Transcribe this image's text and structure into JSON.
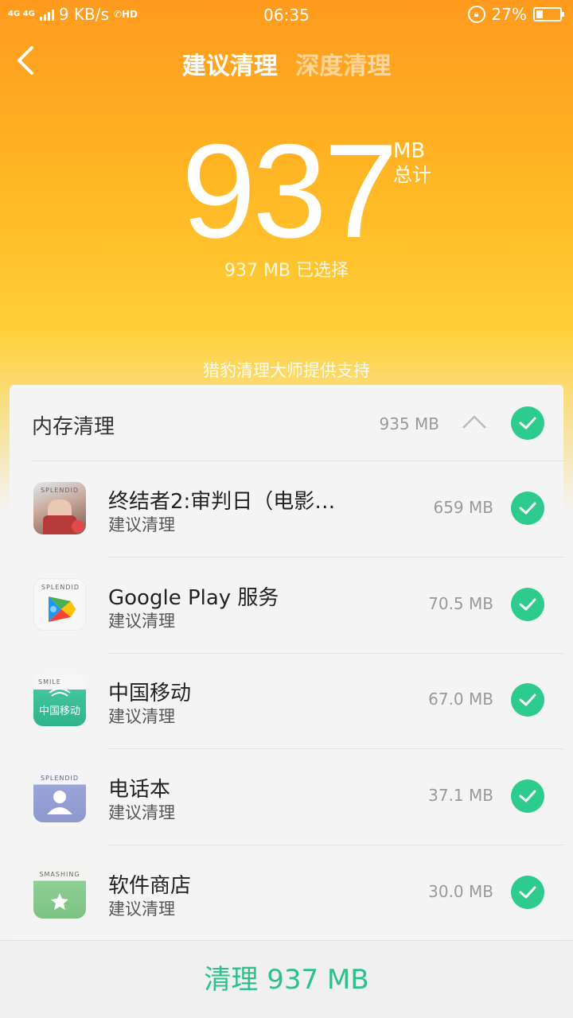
{
  "status_bar": {
    "network": "4G 4G",
    "speed": "9 KB/s",
    "hd_label": "HD",
    "time": "06:35",
    "battery": "27%",
    "battery_level": 0.27
  },
  "nav": {
    "tab_active": "建议清理",
    "tab_inactive": "深度清理"
  },
  "summary": {
    "total_value": "937",
    "unit": "MB",
    "total_label": "总计",
    "selected_text": "937 MB 已选择",
    "provider": "猎豹清理大师提供支持"
  },
  "section": {
    "title": "内存清理",
    "size": "935 MB"
  },
  "items": [
    {
      "name": "终结者2:审判日（电影…",
      "sub": "建议清理",
      "size": "659 MB",
      "icon": "game-icon",
      "tag": "SPLENDID"
    },
    {
      "name": "Google Play 服务",
      "sub": "建议清理",
      "size": "70.5 MB",
      "icon": "google-play-icon",
      "tag": "SPLENDID"
    },
    {
      "name": "中国移动",
      "sub": "建议清理",
      "size": "67.0 MB",
      "icon": "china-mobile-icon",
      "tag": "SMILE",
      "icon_text": "中国移动"
    },
    {
      "name": "电话本",
      "sub": "建议清理",
      "size": "37.1 MB",
      "icon": "contacts-icon",
      "tag": "SPLENDID"
    },
    {
      "name": "软件商店",
      "sub": "建议清理",
      "size": "30.0 MB",
      "icon": "app-store-icon",
      "tag": "SMASHING"
    }
  ],
  "bottom_button": "清理 937 MB",
  "colors": {
    "accent_green": "#2ecb8e",
    "header_orange": "#ff9a1e",
    "header_yellow": "#ffd038"
  }
}
